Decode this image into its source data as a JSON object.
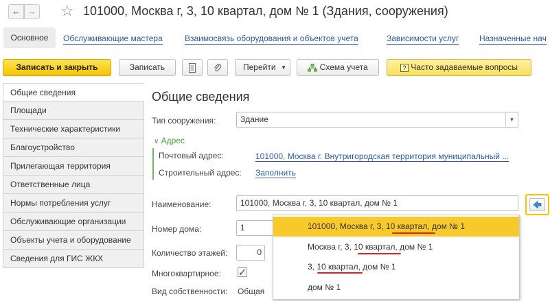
{
  "titlebar": {
    "title": "101000, Москва г, 3, 10 квартал, дом № 1 (Здания, сооружения)",
    "back_icon": "arrow-left-icon",
    "forward_icon": "arrow-right-icon",
    "favorite_icon": "star-icon"
  },
  "tabs": [
    {
      "label": "Основное",
      "active": true
    },
    {
      "label": "Обслуживающие мастера"
    },
    {
      "label": "Взаимосвязь оборудования и объектов учета"
    },
    {
      "label": "Зависимости услуг"
    },
    {
      "label": "Назначенные нач"
    }
  ],
  "toolbar": {
    "save_close": "Записать и закрыть",
    "save": "Записать",
    "goto": "Перейти",
    "scheme": "Схема учета",
    "faq": "Часто задаваемые вопросы"
  },
  "sidebar": {
    "items": [
      {
        "label": "Общие сведения",
        "active": true
      },
      {
        "label": "Площади"
      },
      {
        "label": "Технические характеристики"
      },
      {
        "label": "Благоустройство"
      },
      {
        "label": "Прилегающая территория"
      },
      {
        "label": "Ответственные лица"
      },
      {
        "label": "Нормы потребления услуг"
      },
      {
        "label": "Обслуживающие организации"
      },
      {
        "label": "Объекты учета и оборудование"
      },
      {
        "label": "Сведения для ГИС ЖКХ"
      }
    ]
  },
  "form": {
    "section_title": "Общие сведения",
    "type_label": "Тип сооружения:",
    "type_value": "Здание",
    "address_group": "Адрес",
    "postal_label": "Почтовый адрес:",
    "postal_value": "101000, Москва г. Внутригородская территория муниципальный ...",
    "build_label": "Строительный адрес:",
    "build_value": "Заполнить",
    "name_label": "Наименование:",
    "name_value": "101000, Москва г, 3, 10 квартал, дом № 1",
    "house_label": "Номер дома:",
    "house_value": "1",
    "floors_label": "Количество этажей:",
    "floors_value": "0",
    "multi_label": "Многоквартирное:",
    "multi_checked": true,
    "own_label": "Вид собственности:",
    "own_value": "Общая"
  },
  "popup": {
    "options": [
      {
        "text": "101000, Москва г, 3, 10 квартал, дом № 1",
        "selected": true
      },
      {
        "text": "Москва г, 3, 10 квартал, дом № 1"
      },
      {
        "text": "3, 10 квартал, дом № 1"
      },
      {
        "text": "дом № 1"
      }
    ]
  },
  "colors": {
    "accent_yellow": "#f5c400",
    "link_blue": "#2c5a9b",
    "group_green": "#4c9a3e",
    "highlight_red": "#e02020"
  }
}
